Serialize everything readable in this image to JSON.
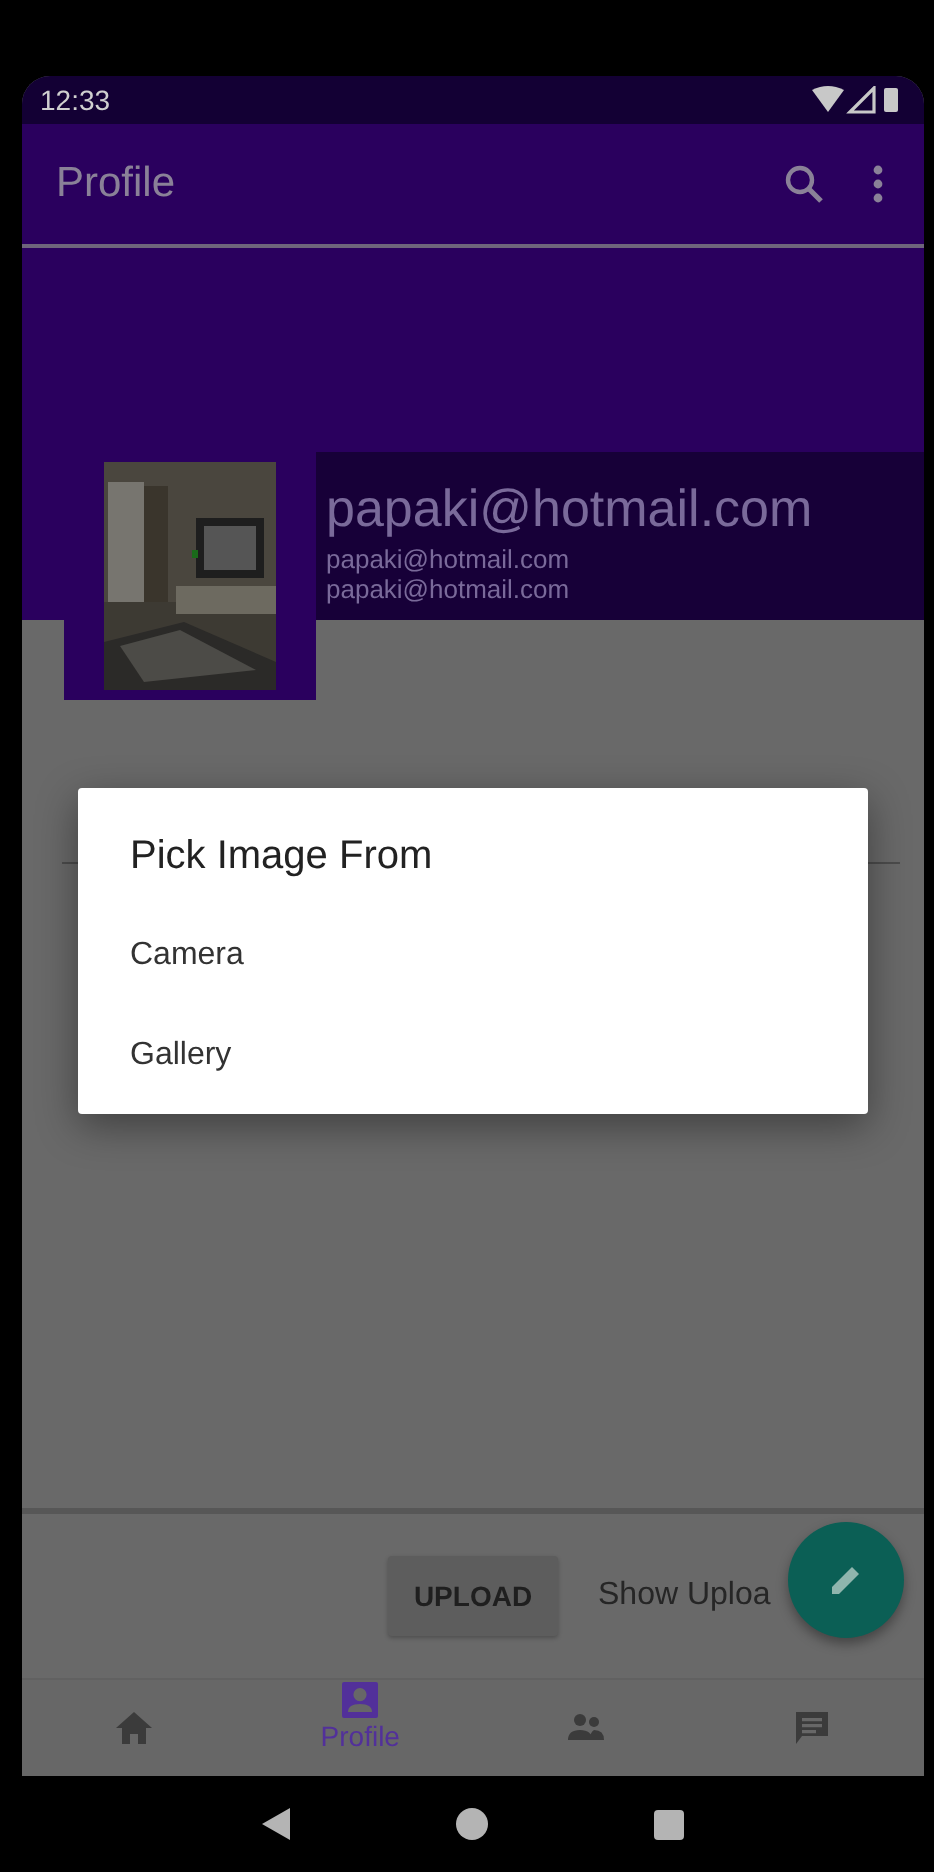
{
  "status_bar": {
    "time": "12:33"
  },
  "app_bar": {
    "title": "Profile"
  },
  "profile": {
    "name": "papaki@hotmail.com",
    "lines": [
      "papaki@hotmail.com",
      "papaki@hotmail.com"
    ]
  },
  "dialog": {
    "title": "Pick Image From",
    "options": [
      "Camera",
      "Gallery"
    ]
  },
  "actions": {
    "upload": "UPLOAD",
    "show_uploads": "Show Uploa"
  },
  "bottom_nav": [
    {
      "kind": "home",
      "selected": false
    },
    {
      "kind": "profile",
      "label": "Profile",
      "selected": true
    },
    {
      "kind": "people",
      "selected": false
    },
    {
      "kind": "chat",
      "selected": false
    }
  ]
}
